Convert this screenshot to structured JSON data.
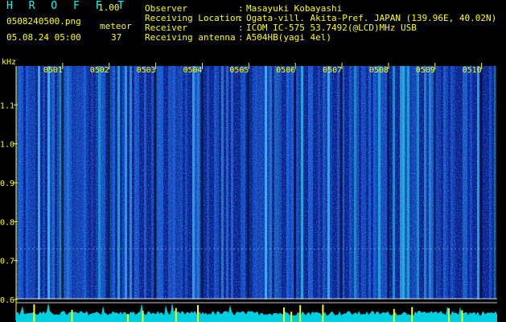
{
  "header": {
    "app_title": "H R O F F T",
    "app_version": "1.00",
    "filename": "0508240500.png",
    "datetime": "05.08.24 05:00",
    "meteor_label": "meteor",
    "meteor_count": "37"
  },
  "meta": [
    {
      "key": "Observer",
      "value": "Masayuki Kobayashi"
    },
    {
      "key": "Receiving Location",
      "value": "Ogata-vill. Akita-Pref. JAPAN (139.96E, 40.02N)"
    },
    {
      "key": "Receiver",
      "value": "ICOM IC-575 53.7492(@LCD)MHz USB"
    },
    {
      "key": "Receiving antenna",
      "value": "A504HB(yagi 4el)"
    }
  ],
  "colors": {
    "background": "#000000",
    "text": "#ffff00",
    "title": "#00ffff",
    "spectrum_low": "#0a1a8a",
    "spectrum_mid": "#1e5fe0",
    "spectrum_high": "#33e0ff"
  },
  "chart_data": {
    "type": "heatmap",
    "ylabel": "kHz",
    "ylim": [
      0.6,
      1.2
    ],
    "y_ticks": [
      "1.1",
      "1.0",
      "0.9",
      "0.8",
      "0.7",
      "0.6"
    ],
    "y_tick_values": [
      1.1,
      1.0,
      0.9,
      0.8,
      0.7,
      0.6
    ],
    "time_labels": [
      "0501",
      "0502",
      "0503",
      "0504",
      "0505",
      "0506",
      "0507",
      "0508",
      "0509",
      "0510"
    ],
    "xlim": [
      0,
      10.3
    ],
    "time_label_positions": [
      1,
      2,
      3,
      4,
      5,
      6,
      7,
      8,
      9,
      10
    ],
    "carrier_khz": 0.73
  }
}
